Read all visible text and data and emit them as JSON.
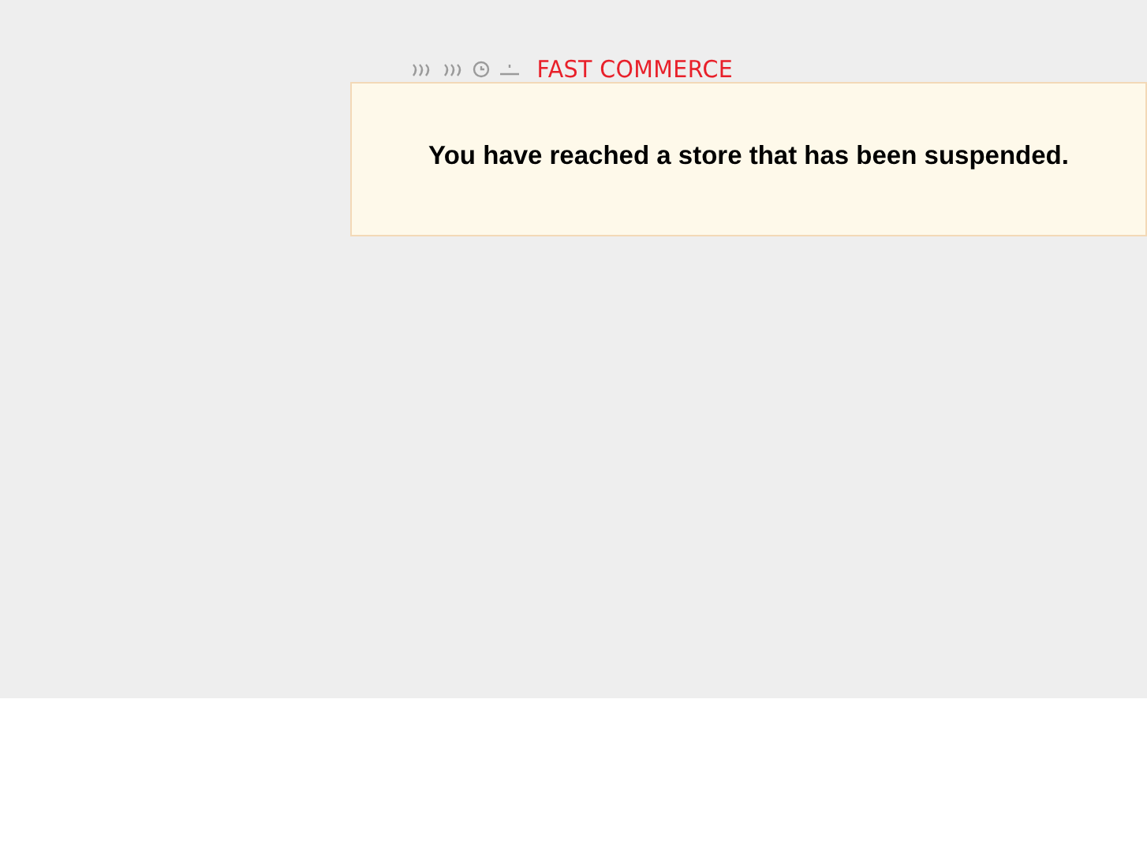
{
  "logo": {
    "text": "FAST COMMERCE"
  },
  "notice": {
    "message": "You have reached a store that has been suspended."
  }
}
